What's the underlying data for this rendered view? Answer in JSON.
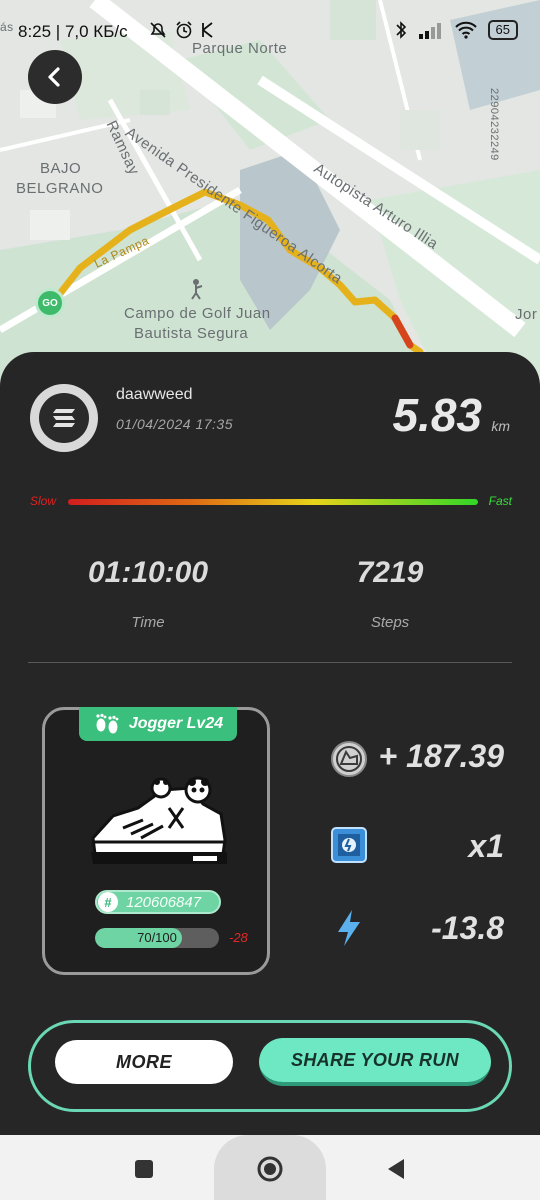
{
  "status_bar": {
    "time_and_speed": "8:25 | 7,0 КБ/с",
    "battery": "65"
  },
  "map": {
    "labels": {
      "parque_norte": "Parque Norte",
      "avenida": "Avenida Presidente Figueroa Alcorta",
      "ramsay": "Ramsay",
      "bajo_belgrano_1": "BAJO",
      "bajo_belgrano_2": "BELGRANO",
      "autopista": "Autopista Arturo Illia",
      "campo_golf_1": "Campo de Golf Juan",
      "campo_golf_2": "Bautista Segura",
      "la_pampa": "La Pampa",
      "number_vertical": "22904232249",
      "jor": "Jor",
      "mas": "ás"
    },
    "go_marker": "GO"
  },
  "run": {
    "username": "daawweed",
    "datetime": "01/04/2024 17:35",
    "distance": "5.83",
    "distance_unit": "km",
    "speed_slow": "Slow",
    "speed_fast": "Fast",
    "time_value": "01:10:00",
    "time_label": "Time",
    "steps_value": "7219",
    "steps_label": "Steps"
  },
  "shoe": {
    "level": "Jogger Lv24",
    "id": "120606847",
    "durability": "70/100",
    "durability_fraction": 0.7,
    "durability_loss": "-28"
  },
  "rewards": {
    "earned": "+ 187.39",
    "multiplier": "x1",
    "energy": "-13.8"
  },
  "buttons": {
    "more": "MORE",
    "share": "SHARE YOUR RUN"
  },
  "colors": {
    "accent_green": "#6ee8c3",
    "sheet_bg": "#262626",
    "route": "#e5b21c"
  }
}
